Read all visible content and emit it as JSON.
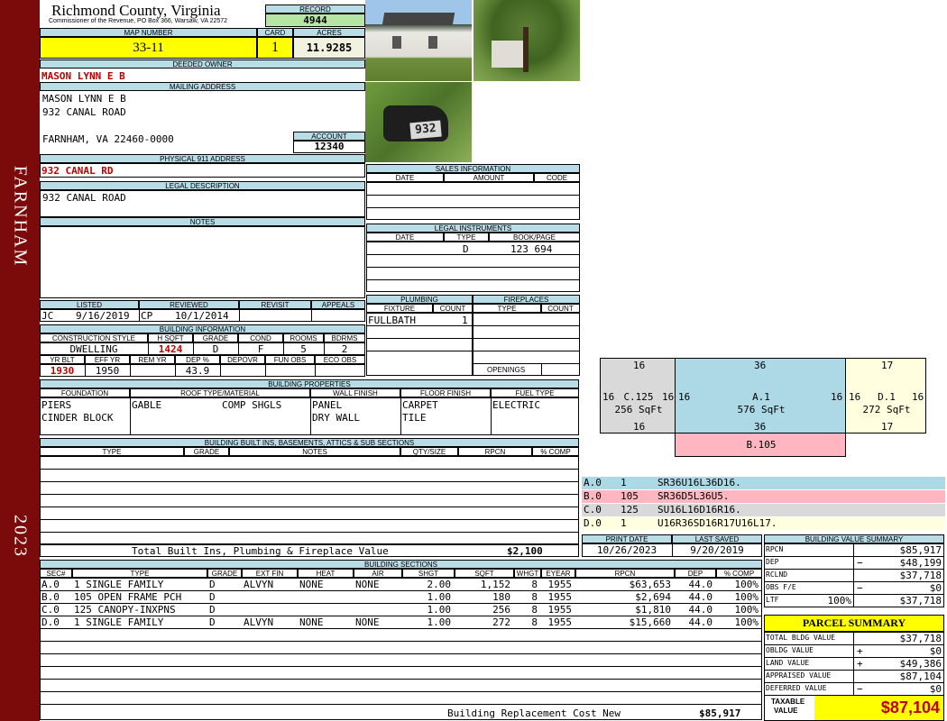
{
  "sidebar": {
    "town": "FARNHAM",
    "year": "2023",
    "color": "#7b0a0a"
  },
  "header": {
    "county": "Richmond County, Virginia",
    "commissioner": "Commissioner of the Revenue, PO Box 366, Warsaw, VA 22572",
    "record_label": "RECORD",
    "record": "4944",
    "map_label": "MAP NUMBER",
    "map_number": "33-11",
    "card_label": "CARD",
    "card": "1",
    "acres_label": "ACRES",
    "acres": "11.9285"
  },
  "owner": {
    "deeded_label": "DEEDED OWNER",
    "deeded": "MASON LYNN E B",
    "mailing_label": "MAILING ADDRESS",
    "mail1": "MASON LYNN E B",
    "mail2": "932 CANAL ROAD",
    "mail3": "FARNHAM, VA 22460-0000",
    "account_label": "ACCOUNT",
    "account": "12340",
    "physical_label": "PHYSICAL 911 ADDRESS",
    "physical": "932 CANAL RD",
    "legal_label": "LEGAL DESCRIPTION",
    "legal": "932 CANAL ROAD",
    "notes_label": "NOTES"
  },
  "photos": {
    "mailbox_number": "932"
  },
  "sales": {
    "label": "SALES INFORMATION",
    "cols": [
      "DATE",
      "AMOUNT",
      "CODE"
    ]
  },
  "legal_instruments": {
    "label": "LEGAL INSTRUMENTS",
    "cols": [
      "DATE",
      "TYPE",
      "BOOK/PAGE"
    ],
    "rows": [
      {
        "date": "",
        "type": "D",
        "book": "123 694"
      }
    ]
  },
  "listing": {
    "listed_label": "LISTED",
    "reviewed_label": "REVIEWED",
    "revisit_label": "REVISIT",
    "appeals_label": "APPEALS",
    "listed_by": "JC",
    "listed_date": "9/16/2019",
    "reviewed_by": "CP",
    "reviewed_date": "10/1/2014"
  },
  "building_info": {
    "label": "BUILDING INFORMATION",
    "h": [
      "CONSTRUCTION STYLE",
      "H SQFT",
      "GRADE",
      "COND",
      "ROOMS",
      "BDRMS"
    ],
    "style": "DWELLING",
    "hsqft": "1424",
    "grade": "D",
    "cond": "F",
    "rooms": "5",
    "bdrms": "2",
    "h2": [
      "YR BLT",
      "EFF YR",
      "REM YR",
      "DEP %",
      "DEPOVR",
      "FUN OBS",
      "ECO OBS"
    ],
    "yrblt": "1930",
    "effyr": "1950",
    "dep": "43.9"
  },
  "plumbing": {
    "label": "PLUMBING",
    "fixture_label": "FIXTURE",
    "count_label": "COUNT",
    "fixture": "FULLBATH",
    "count": "1"
  },
  "fireplaces": {
    "label": "FIREPLACES",
    "type_label": "TYPE",
    "count_label": "COUNT",
    "openings_label": "OPENINGS"
  },
  "properties": {
    "label": "BUILDING PROPERTIES",
    "cols": [
      "FOUNDATION",
      "ROOF TYPE/MATERIAL",
      "WALL FINISH",
      "FLOOR FINISH",
      "FUEL TYPE"
    ],
    "foundation1": "PIERS",
    "foundation2": "CINDER BLOCK",
    "roof1": "GABLE",
    "roof2": "COMP SHGLS",
    "wall1": "PANEL",
    "wall2": "DRY WALL",
    "floor1": "CARPET",
    "floor2": "TILE",
    "fuel": "ELECTRIC"
  },
  "builtins": {
    "label": "BUILDING BUILT INS, BASEMENTS, ATTICS & SUB SECTIONS",
    "cols": [
      "TYPE",
      "GRADE",
      "NOTES",
      "QTY/SIZE",
      "RPCN",
      "% COMP"
    ],
    "total_label": "Total Built Ins, Plumbing & Fireplace Value",
    "total": "$2,100"
  },
  "dates": {
    "print_label": "PRINT DATE",
    "print": "10/26/2023",
    "saved_label": "LAST SAVED",
    "saved": "9/20/2019"
  },
  "sections": {
    "label": "BUILDING SECTIONS",
    "cols": [
      "SEC#",
      "TYPE",
      "GRADE",
      "EXT FIN",
      "HEAT",
      "AIR",
      "SHGT",
      "SQFT",
      "WHGT",
      "EYEAR",
      "RPCN",
      "DEP",
      "% COMP"
    ],
    "rows": [
      {
        "sec": "A.0",
        "type": "1 SINGLE FAMILY",
        "grade": "D",
        "ext": "ALVYN",
        "heat": "NONE",
        "air": "NONE",
        "shgt": "2.00",
        "sqft": "1,152",
        "whgt": "8",
        "eyear": "1955",
        "rpcn": "$63,653",
        "dep": "44.0",
        "comp": "100%"
      },
      {
        "sec": "B.0",
        "type": "105 OPEN FRAME PCH",
        "grade": "D",
        "ext": "",
        "heat": "",
        "air": "",
        "shgt": "1.00",
        "sqft": "180",
        "whgt": "8",
        "eyear": "1955",
        "rpcn": "$2,694",
        "dep": "44.0",
        "comp": "100%"
      },
      {
        "sec": "C.0",
        "type": "125 CANOPY-INXPNS",
        "grade": "D",
        "ext": "",
        "heat": "",
        "air": "",
        "shgt": "1.00",
        "sqft": "256",
        "whgt": "8",
        "eyear": "1955",
        "rpcn": "$1,810",
        "dep": "44.0",
        "comp": "100%"
      },
      {
        "sec": "D.0",
        "type": "1 SINGLE FAMILY",
        "grade": "D",
        "ext": "ALVYN",
        "heat": "NONE",
        "air": "NONE",
        "shgt": "1.00",
        "sqft": "272",
        "whgt": "8",
        "eyear": "1955",
        "rpcn": "$15,660",
        "dep": "44.0",
        "comp": "100%"
      }
    ],
    "brcn_label": "Building Replacement Cost New",
    "brcn": "$85,917"
  },
  "sketch": {
    "c": {
      "top": "16",
      "bottom": "16",
      "left": "16",
      "right": "16",
      "label": "C.125",
      "area": "256 SqFt",
      "color": "#d9d9d9"
    },
    "a": {
      "top": "36",
      "bottom": "36",
      "left": "16",
      "right": "16",
      "label": "A.1",
      "area": "576 SqFt",
      "color": "#add8e6"
    },
    "d": {
      "top": "17",
      "bottom": "17",
      "left": "16",
      "right": "16",
      "label": "D.1",
      "area": "272 SqFt",
      "color": "#ffffe0"
    },
    "b": {
      "label": "B.105",
      "color": "#ffb6c1"
    }
  },
  "legend": [
    {
      "code": "A.0",
      "n": "1",
      "path": "SR36U16L36D16.",
      "color": "#add8e6"
    },
    {
      "code": "B.0",
      "n": "105",
      "path": "SR36D5L36U5.",
      "color": "#ffb6c1"
    },
    {
      "code": "C.0",
      "n": "125",
      "path": "SU16L16D16R16.",
      "color": "#d9d9d9"
    },
    {
      "code": "D.0",
      "n": "1",
      "path": "U16R36SD16R17U16L17.",
      "color": "#ffffe0"
    }
  ],
  "value_summary": {
    "label": "BUILDING VALUE SUMMARY",
    "rows": [
      {
        "k": "RPCN",
        "s": "",
        "v": "$85,917"
      },
      {
        "k": "DEP",
        "s": "−",
        "v": "$48,199"
      },
      {
        "k": "RCLND",
        "s": "",
        "v": "$37,718"
      },
      {
        "k": "OBS F/E",
        "s": "−",
        "v": "$0"
      },
      {
        "k": "LTF",
        "p": "100%",
        "s": "",
        "v": "$37,718"
      }
    ]
  },
  "parcel": {
    "label": "PARCEL SUMMARY",
    "rows": [
      {
        "k": "TOTAL BLDG VALUE",
        "s": "",
        "v": "$37,718"
      },
      {
        "k": "OBLDG VALUE",
        "s": "+",
        "v": "$0"
      },
      {
        "k": "LAND VALUE",
        "s": "+",
        "v": "$49,386"
      },
      {
        "k": "APPRAISED VALUE",
        "s": "",
        "v": "$87,104"
      },
      {
        "k": "DEFERRED VALUE",
        "s": "−",
        "v": "$0"
      }
    ],
    "taxable_label1": "TAXABLE",
    "taxable_label2": "VALUE",
    "taxable": "$87,104"
  }
}
